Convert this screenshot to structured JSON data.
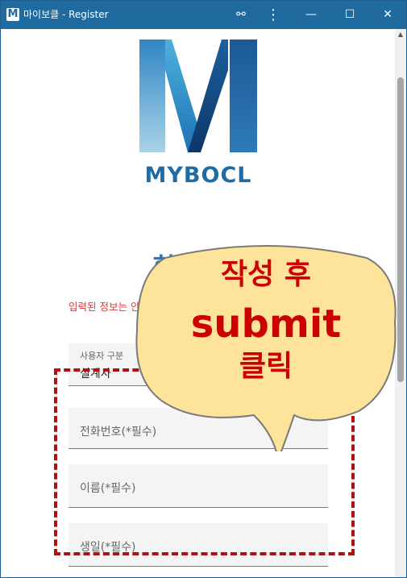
{
  "window": {
    "app_icon_letter": "M",
    "title": "마이보클 - Register"
  },
  "titlebar_buttons": {
    "extension_icon": "⚯",
    "more_icon": "⋮",
    "minimize_icon": "—",
    "maximize_icon": "☐",
    "close_icon": "✕"
  },
  "scroll_up_icon": "▲",
  "brand": {
    "name": "MYBOCL",
    "colors": {
      "primary": "#1f6ca5",
      "light": "#3d9fd0",
      "dark": "#123f73"
    }
  },
  "form": {
    "title": "회원가입",
    "notice": "입력된 정보는 안전하게 보관되며 다른 용도로 사용되지 않습니다",
    "user_type_label": "사용자 구분",
    "user_type_value": "설계사",
    "phone_placeholder": "전화번호(*필수)",
    "name_placeholder": "이름(*필수)",
    "birthday_placeholder": "생일(*필수)"
  },
  "annotation": {
    "line1": "작성 후",
    "line2": "submit",
    "line3": "클릭",
    "bubble_color": "#fde49a",
    "text_color": "#cc0000",
    "box_color": "#b01010"
  }
}
